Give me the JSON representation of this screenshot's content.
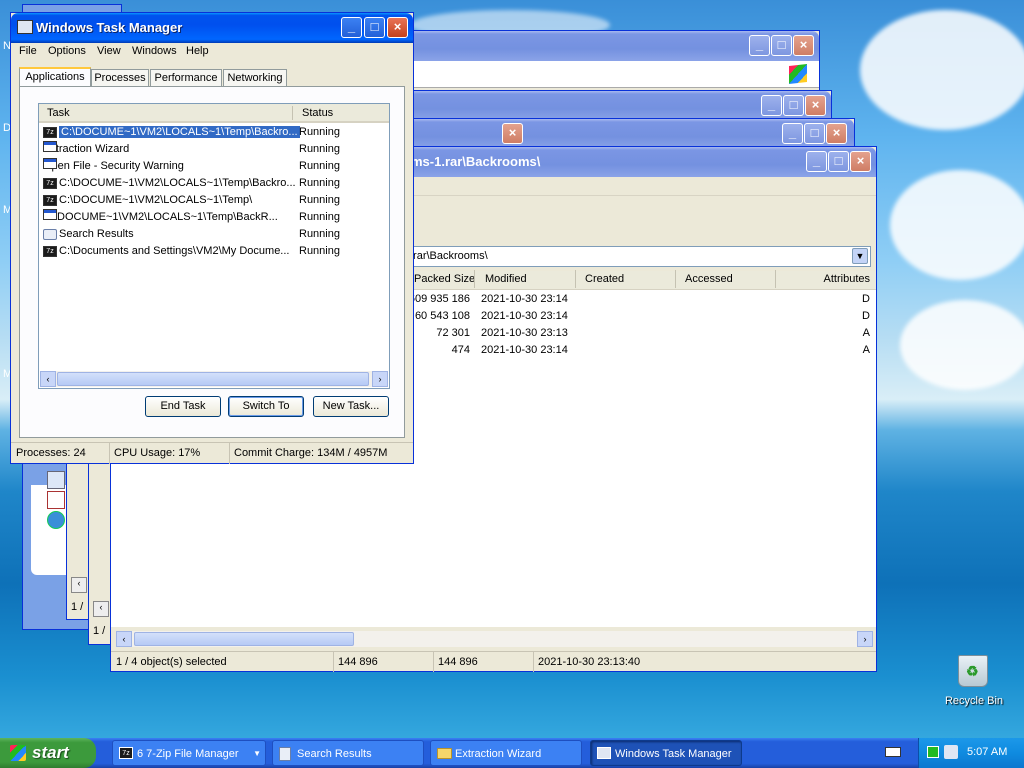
{
  "desktop": {
    "left_icon_letters": [
      "N",
      "D",
      "M",
      "M"
    ],
    "recycle_bin_label": "Recycle Bin"
  },
  "zip_window": {
    "path_title": "ms-1.rar\\Backrooms\\",
    "address_value": ".rar\\Backrooms\\",
    "columns": [
      "Packed Size",
      "Modified",
      "Created",
      "Accessed",
      "Attributes"
    ],
    "rows": [
      {
        "packed": "609 935 186",
        "modified": "2021-10-30 23:14",
        "attr": "D"
      },
      {
        "packed": "60 543 108",
        "modified": "2021-10-30 23:14",
        "attr": "D"
      },
      {
        "packed": "72 301",
        "modified": "2021-10-30 23:13",
        "attr": "A"
      },
      {
        "packed": "474",
        "modified": "2021-10-30 23:14",
        "attr": "A"
      }
    ],
    "status": {
      "selected": "1 / 4 object(s) selected",
      "size": "144 896",
      "packed": "144 896",
      "modified": "2021-10-30 23:13:40"
    }
  },
  "behind_windows": {
    "status_partial_1": "1 /",
    "status_partial_2": "1 /"
  },
  "task_manager": {
    "title": "Windows Task Manager",
    "menu": [
      "File",
      "Options",
      "View",
      "Windows",
      "Help"
    ],
    "tabs": [
      "Applications",
      "Processes",
      "Performance",
      "Networking"
    ],
    "list_headers": {
      "task": "Task",
      "status": "Status"
    },
    "tasks": [
      {
        "name": "C:\\DOCUME~1\\VM2\\LOCALS~1\\Temp\\Backro...",
        "status": "Running",
        "icon": "7zip-icon"
      },
      {
        "name": "Extraction Wizard",
        "status": "Running",
        "icon": "window-icon"
      },
      {
        "name": "Open File - Security Warning",
        "status": "Running",
        "icon": "window-icon"
      },
      {
        "name": "C:\\DOCUME~1\\VM2\\LOCALS~1\\Temp\\Backro...",
        "status": "Running",
        "icon": "7zip-icon"
      },
      {
        "name": "C:\\DOCUME~1\\VM2\\LOCALS~1\\Temp\\",
        "status": "Running",
        "icon": "7zip-icon"
      },
      {
        "name": "C:\\DOCUME~1\\VM2\\LOCALS~1\\Temp\\BackR...",
        "status": "Running",
        "icon": "window-icon"
      },
      {
        "name": "Search Results",
        "status": "Running",
        "icon": "search-results-icon"
      },
      {
        "name": "C:\\Documents and Settings\\VM2\\My Docume...",
        "status": "Running",
        "icon": "7zip-icon"
      }
    ],
    "buttons": {
      "end_task": "End Task",
      "switch_to": "Switch To",
      "new_task": "New Task..."
    },
    "status_bar": {
      "processes": "Processes: 24",
      "cpu": "CPU Usage: 17%",
      "commit": "Commit Charge: 134M / 4957M"
    }
  },
  "taskbar": {
    "start_label": "start",
    "items": [
      {
        "label": "6 7-Zip File Manager",
        "icon": "7zip-icon"
      },
      {
        "label": "Search Results",
        "icon": "search-results-icon"
      },
      {
        "label": "Extraction Wizard",
        "icon": "folder-icon"
      },
      {
        "label": "Windows Task Manager",
        "icon": "task-manager-icon"
      }
    ],
    "clock": "5:07 AM"
  },
  "colors": {
    "xp_blue": "#0053ee",
    "taskbar": "#245edb",
    "start_green": "#3c9a3c",
    "selection": "#316ac5"
  }
}
